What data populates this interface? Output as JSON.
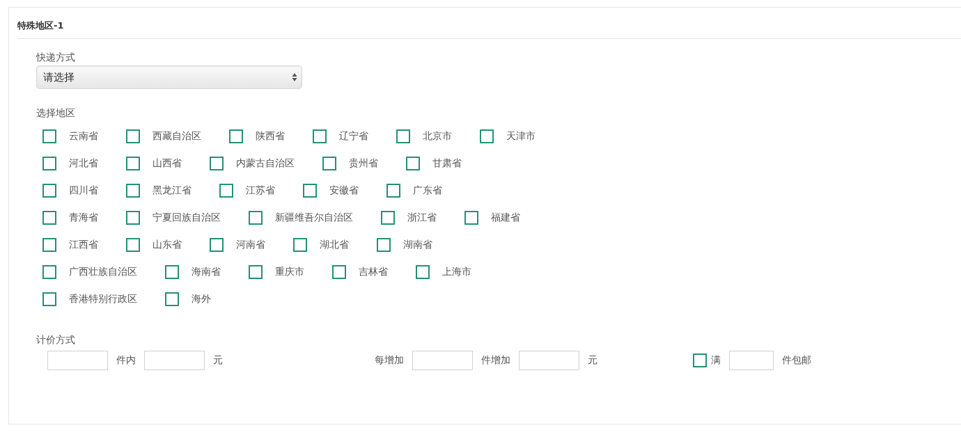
{
  "panel": {
    "title": "特殊地区-1"
  },
  "shipping": {
    "label": "快递方式",
    "select": {
      "value": "请选择"
    }
  },
  "regions": {
    "label": "选择地区",
    "rows": [
      [
        {
          "name": "云南省",
          "checked": false
        },
        {
          "name": "西藏自治区",
          "checked": false
        },
        {
          "name": "陕西省",
          "checked": false
        },
        {
          "name": "辽宁省",
          "checked": false
        },
        {
          "name": "北京市",
          "checked": false
        },
        {
          "name": "天津市",
          "checked": false
        }
      ],
      [
        {
          "name": "河北省",
          "checked": false
        },
        {
          "name": "山西省",
          "checked": false
        },
        {
          "name": "内蒙古自治区",
          "checked": false
        },
        {
          "name": "贵州省",
          "checked": false
        },
        {
          "name": "甘肃省",
          "checked": false
        }
      ],
      [
        {
          "name": "四川省",
          "checked": false
        },
        {
          "name": "黑龙江省",
          "checked": false
        },
        {
          "name": "江苏省",
          "checked": false
        },
        {
          "name": "安徽省",
          "checked": false
        },
        {
          "name": "广东省",
          "checked": false
        }
      ],
      [
        {
          "name": "青海省",
          "checked": false
        },
        {
          "name": "宁夏回族自治区",
          "checked": false
        },
        {
          "name": "新疆维吾尔自治区",
          "checked": false
        },
        {
          "name": "浙江省",
          "checked": false
        },
        {
          "name": "福建省",
          "checked": false
        }
      ],
      [
        {
          "name": "江西省",
          "checked": false
        },
        {
          "name": "山东省",
          "checked": false
        },
        {
          "name": "河南省",
          "checked": false
        },
        {
          "name": "湖北省",
          "checked": false
        },
        {
          "name": "湖南省",
          "checked": false
        }
      ],
      [
        {
          "name": "广西壮族自治区",
          "checked": false
        },
        {
          "name": "海南省",
          "checked": false
        },
        {
          "name": "重庆市",
          "checked": false
        },
        {
          "name": "吉林省",
          "checked": false
        },
        {
          "name": "上海市",
          "checked": false
        }
      ],
      [
        {
          "name": "香港特别行政区",
          "checked": false
        },
        {
          "name": "海外",
          "checked": false
        }
      ]
    ]
  },
  "pricing": {
    "label": "计价方式",
    "groups": [
      [
        {
          "kind": "input"
        },
        {
          "kind": "text",
          "text": "件内"
        },
        {
          "kind": "input"
        },
        {
          "kind": "text",
          "text": "元"
        }
      ],
      [
        {
          "kind": "text",
          "text": "每增加"
        },
        {
          "kind": "input"
        },
        {
          "kind": "text",
          "text": "件增加"
        },
        {
          "kind": "input"
        },
        {
          "kind": "text",
          "text": "元"
        }
      ],
      [
        {
          "kind": "checkbox",
          "text": "满",
          "checked": false
        },
        {
          "kind": "input",
          "narrow": true
        },
        {
          "kind": "text",
          "text": "件包邮"
        }
      ]
    ]
  }
}
